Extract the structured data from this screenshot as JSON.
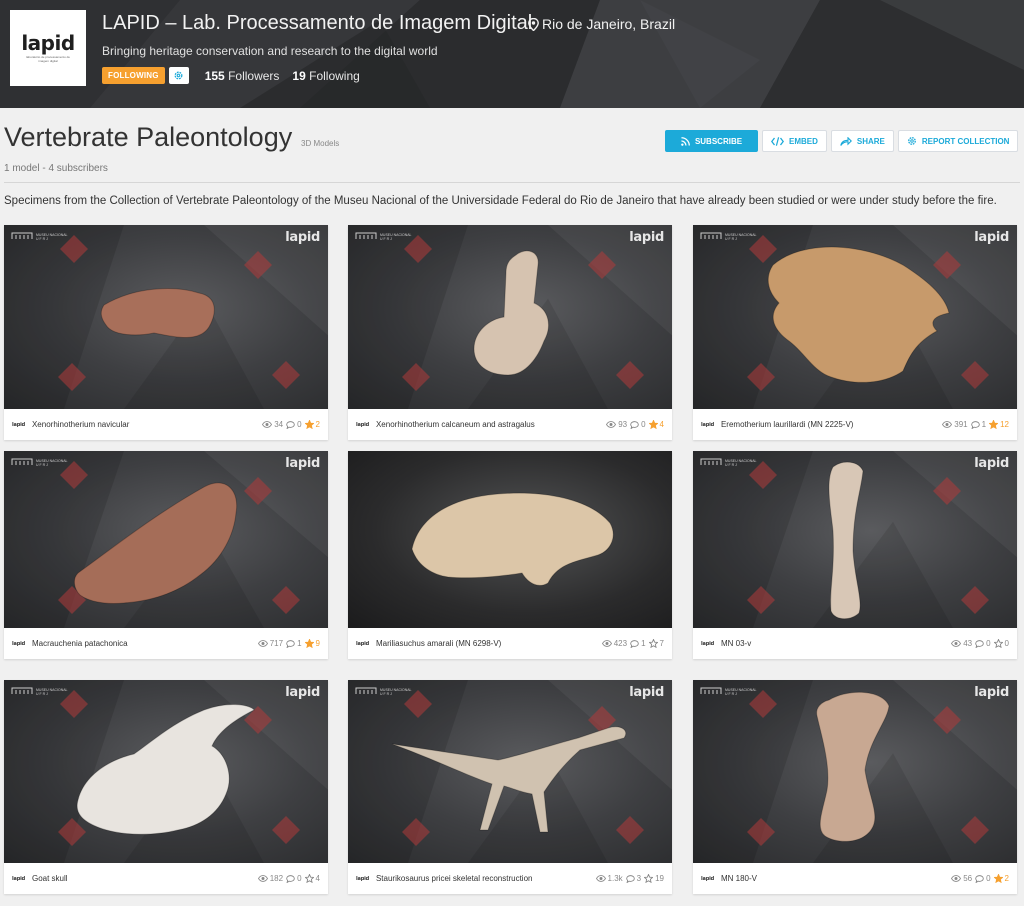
{
  "org": {
    "logo_text": "lapid",
    "logo_subtext": "laboratório de processamento de imagem digital",
    "title": "LAPID – Lab. Processamento de Imagem Digital",
    "location": "Rio de Janeiro, Brazil",
    "tagline": "Bringing heritage conservation and research to the digital world",
    "following_label": "FOLLOWING",
    "followers_count": "155",
    "followers_label": "Followers",
    "following_count": "19",
    "following_label2": "Following"
  },
  "collection": {
    "title": "Vertebrate Paleontology",
    "type": "3D Models",
    "meta": "1 model - 4 subscribers",
    "description": "Specimens from the Collection of Vertebrate Paleontology of the Museu Nacional of the Universidade Federal do Rio de Janeiro that have already been studied or were under study before the fire."
  },
  "actions": {
    "subscribe": "SUBSCRIBE",
    "embed": "EMBED",
    "share": "SHARE",
    "report": "REPORT COLLECTION"
  },
  "card_branding": {
    "museum_text": "MUSEU NACIONAL",
    "museum_subtext": "U F R J",
    "lapid_mark": "lapid",
    "foot_logo": "lapid"
  },
  "models": [
    {
      "name": "Xenorhinotherium navicular",
      "views": "34",
      "comments": "0",
      "likes": "2",
      "liked": true
    },
    {
      "name": "Xenorhinotherium calcaneum and astragalus",
      "views": "93",
      "comments": "0",
      "likes": "4",
      "liked": true
    },
    {
      "name": "Eremotherium laurillardi (MN 2225-V)",
      "views": "391",
      "comments": "1",
      "likes": "12",
      "liked": true
    },
    {
      "name": "Macrauchenia patachonica",
      "views": "717",
      "comments": "1",
      "likes": "9",
      "liked": true
    },
    {
      "name": "Mariliasuchus amarali (MN 6298-V)",
      "views": "423",
      "comments": "1",
      "likes": "7",
      "liked": false
    },
    {
      "name": "MN 03-v",
      "views": "43",
      "comments": "0",
      "likes": "0",
      "liked": false
    },
    {
      "name": "Goat skull",
      "views": "182",
      "comments": "0",
      "likes": "4",
      "liked": false
    },
    {
      "name": "Staurikosaurus pricei skeletal reconstruction",
      "views": "1.3k",
      "comments": "3",
      "likes": "19",
      "liked": false
    },
    {
      "name": "MN 180-V",
      "views": "56",
      "comments": "0",
      "likes": "2",
      "liked": true
    }
  ],
  "colors": {
    "accent": "#1caad9",
    "following": "#f6a02f",
    "bone_brown": "#a86f5a",
    "bone_pale": "#e8e4df",
    "diamond_red": "#b03a3a"
  }
}
